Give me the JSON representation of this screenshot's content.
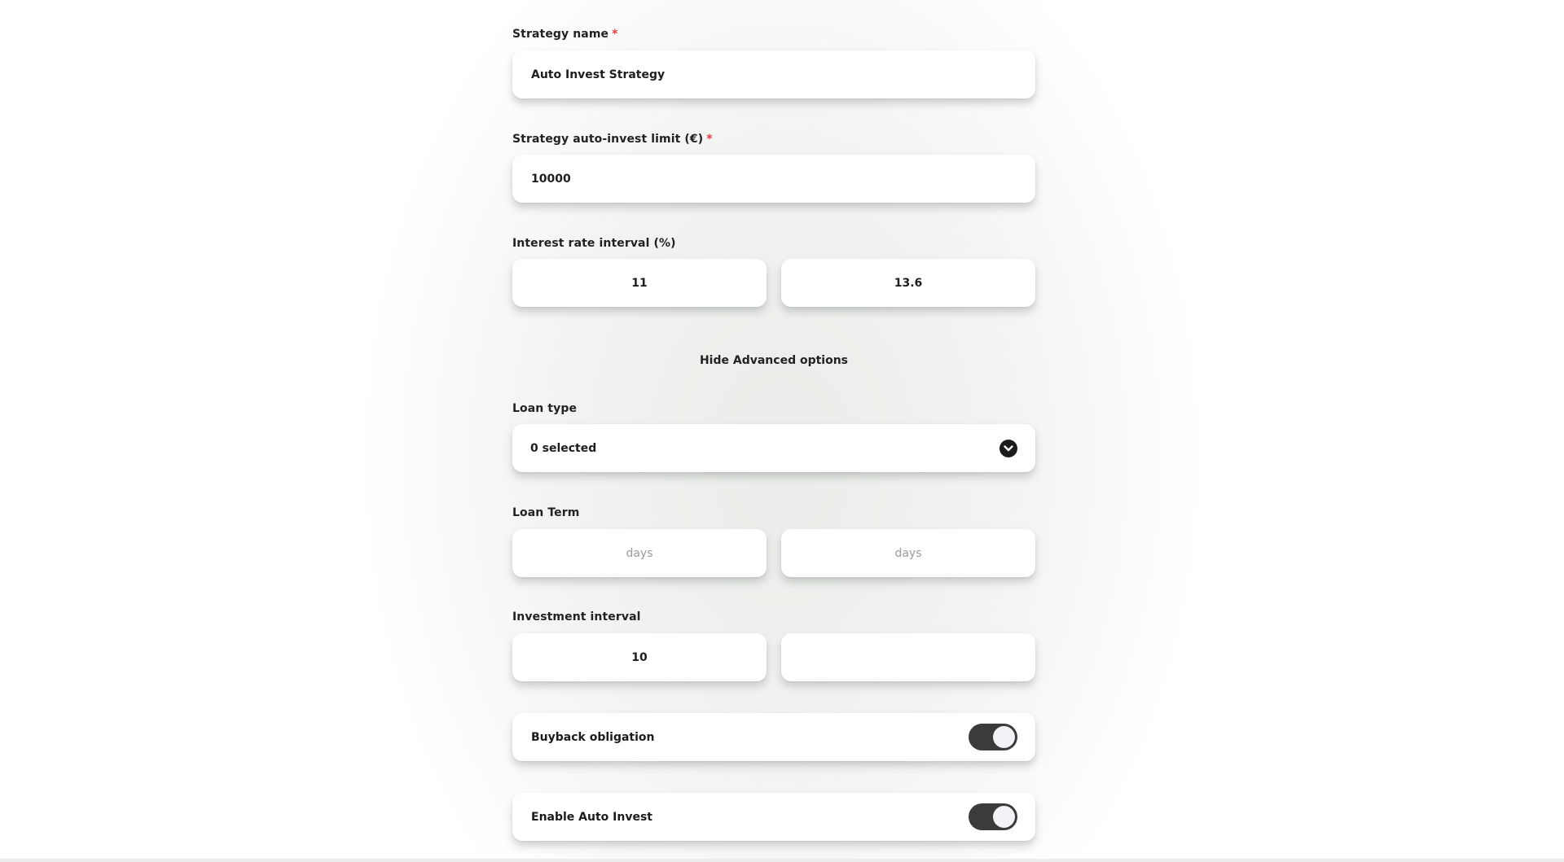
{
  "strategy_name": {
    "label": "Strategy name",
    "required_mark": "*",
    "value": "Auto Invest Strategy"
  },
  "invest_limit": {
    "label": "Strategy auto-invest limit (€)",
    "required_mark": "*",
    "value": "10000"
  },
  "interest_rate": {
    "label": "Interest rate interval (%)",
    "min_value": "11",
    "max_value": "13.6"
  },
  "advanced_toggle_label": "Hide Advanced options",
  "loan_type": {
    "label": "Loan type",
    "selected_text": "0 selected",
    "icon": "chevron-down-icon"
  },
  "loan_term": {
    "label": "Loan Term",
    "min_placeholder": "days",
    "max_placeholder": "days"
  },
  "investment_interval": {
    "label": "Investment interval",
    "min_value": "10",
    "max_value": ""
  },
  "buyback": {
    "label": "Buyback obligation",
    "enabled": true
  },
  "auto_invest": {
    "label": "Enable Auto Invest",
    "enabled": true
  },
  "colors": {
    "required": "#e0393e",
    "toggle_track": "#3a3b3a",
    "toggle_knob": "#f4f2f7"
  }
}
